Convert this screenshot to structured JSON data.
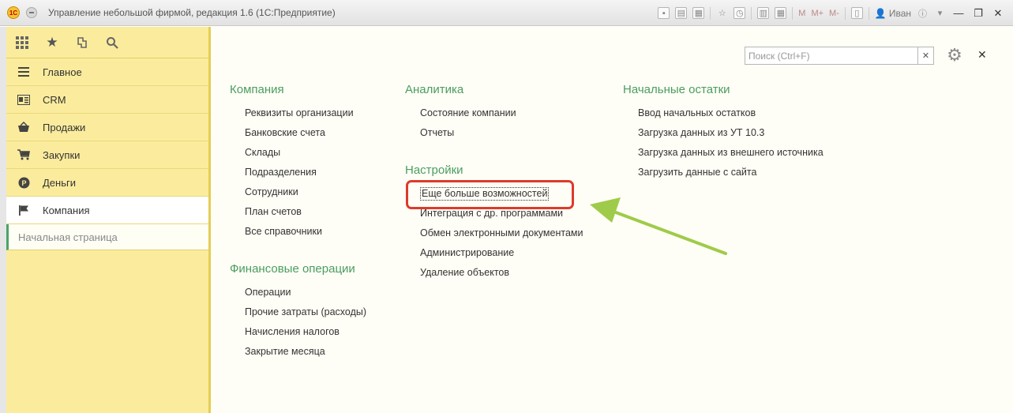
{
  "window": {
    "title": "Управление небольшой фирмой, редакция 1.6  (1С:Предприятие)",
    "user": "Иван",
    "logo_text": "1С"
  },
  "sidebar": {
    "tools": [
      {
        "name": "apps-grid-icon"
      },
      {
        "name": "favorites-star-icon"
      },
      {
        "name": "history-icon"
      },
      {
        "name": "search-icon"
      }
    ],
    "items": [
      {
        "label": "Главное",
        "icon": "menu-lines-icon"
      },
      {
        "label": "CRM",
        "icon": "contact-card-icon"
      },
      {
        "label": "Продажи",
        "icon": "basket-icon"
      },
      {
        "label": "Закупки",
        "icon": "cart-icon"
      },
      {
        "label": "Деньги",
        "icon": "coin-icon"
      },
      {
        "label": "Компания",
        "icon": "flag-icon",
        "active": true
      }
    ],
    "start_page": "Начальная страница"
  },
  "main": {
    "search_placeholder": "Поиск (Ctrl+F)",
    "sections": {
      "company": {
        "title": "Компания",
        "links": [
          "Реквизиты организации",
          "Банковские счета",
          "Склады",
          "Подразделения",
          "Сотрудники",
          "План счетов",
          "Все справочники"
        ]
      },
      "finance": {
        "title": "Финансовые операции",
        "links": [
          "Операции",
          "Прочие затраты (расходы)",
          "Начисления налогов",
          "Закрытие месяца"
        ]
      },
      "analytics": {
        "title": "Аналитика",
        "links": [
          "Состояние компании",
          "Отчеты"
        ]
      },
      "settings": {
        "title": "Настройки",
        "links": [
          "Еще больше возможностей",
          "Интеграция с др. программами",
          "Обмен электронными документами",
          "Администрирование",
          "Удаление объектов"
        ]
      },
      "opening": {
        "title": "Начальные остатки",
        "links": [
          "Ввод начальных остатков",
          "Загрузка данных из УТ 10.3",
          "Загрузка данных из внешнего источника",
          "Загрузить данные с сайта"
        ]
      }
    }
  },
  "colors": {
    "sidebar_bg": "#fbec9d",
    "section_title": "#4a9d60",
    "highlight": "#dd3b2b",
    "arrow": "#9fcb4a"
  }
}
